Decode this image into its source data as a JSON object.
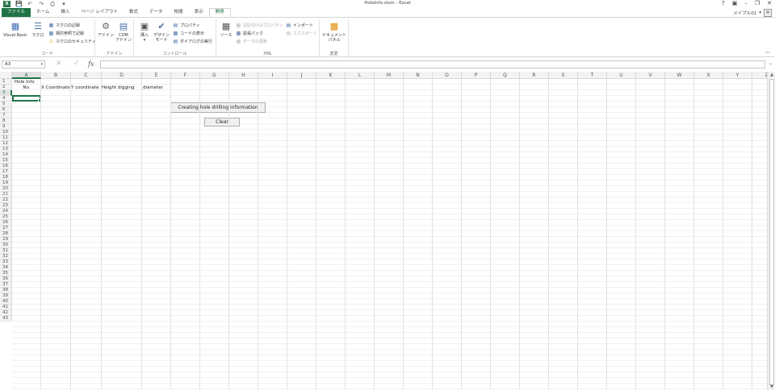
{
  "window": {
    "title": "HoleInfo.xlsm - Excel",
    "app_icon_label": "X",
    "controls": [
      "?",
      "▣",
      "–",
      "❐",
      "✕"
    ],
    "account_name": "メイプル01"
  },
  "tabs": [
    {
      "label": "ファイル",
      "kind": "file"
    },
    {
      "label": "ホーム",
      "kind": "normal"
    },
    {
      "label": "挿入",
      "kind": "normal"
    },
    {
      "label": "ページ レイアウト",
      "kind": "normal"
    },
    {
      "label": "数式",
      "kind": "normal"
    },
    {
      "label": "データ",
      "kind": "normal"
    },
    {
      "label": "校閲",
      "kind": "normal"
    },
    {
      "label": "表示",
      "kind": "normal"
    },
    {
      "label": "開発",
      "kind": "active"
    }
  ],
  "ribbon": {
    "code": {
      "label": "コード",
      "visual_basic": "Visual Basic",
      "macro": "マクロ",
      "record_macro": "マクロの記録",
      "relative_ref": "相対参照で記録",
      "macro_security": "マクロのセキュリティ"
    },
    "addins": {
      "label": "アドイン",
      "addin": "アドイン",
      "com_addin_1": "COM",
      "com_addin_2": "アドイン"
    },
    "controls": {
      "label": "コントロール",
      "insert": "挿入",
      "design_mode_1": "デザイン",
      "design_mode_2": "モード",
      "properties": "プロパティ",
      "view_code": "コードの表示",
      "run_dialog": "ダイアログの実行"
    },
    "xml": {
      "label": "XML",
      "source": "ソース",
      "map_properties": "対応付けのプロパティ",
      "expansion_packs": "拡張パック",
      "refresh_data": "データの更新",
      "import": "インポート",
      "export": "エクスポート"
    },
    "modify": {
      "label": "変更",
      "doc_panel_1": "ドキュメント",
      "doc_panel_2": "パネル"
    }
  },
  "formula_bar": {
    "name_box": "A3",
    "value": "",
    "fx": "fx"
  },
  "grid": {
    "columns": [
      "A",
      "B",
      "C",
      "D",
      "E",
      "F",
      "G",
      "H",
      "I",
      "J",
      "K",
      "L",
      "M",
      "N",
      "O",
      "P",
      "Q",
      "R",
      "S",
      "T",
      "U",
      "V",
      "W",
      "X",
      "Y",
      "Z"
    ],
    "selected_column": "A",
    "selected_row": 3,
    "row_count": 43
  },
  "cells": {
    "A1": "Hole Info",
    "A2": "No.",
    "B2": "X Coordinate",
    "C2": "Y coordinate",
    "D2": "Height digging",
    "E2": "diameter"
  },
  "form_buttons": {
    "create": "Creating hole drilling information",
    "clear": "Clear"
  }
}
